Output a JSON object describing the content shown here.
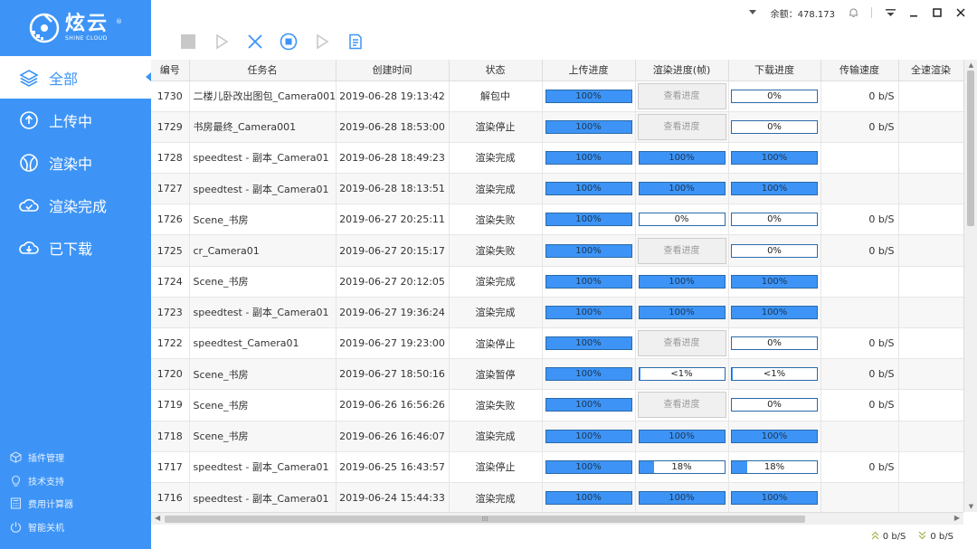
{
  "logo": {
    "name_cn": "炫云",
    "name_en": "SHINE CLOUD",
    "reg": "®"
  },
  "nav": [
    {
      "label": "全部",
      "icon": "layers-icon",
      "active": true
    },
    {
      "label": "上传中",
      "icon": "upload-icon",
      "active": false
    },
    {
      "label": "渲染中",
      "icon": "rendering-icon",
      "active": false
    },
    {
      "label": "渲染完成",
      "icon": "cloud-check-icon",
      "active": false
    },
    {
      "label": "已下载",
      "icon": "cloud-download-icon",
      "active": false
    }
  ],
  "bottom_links": [
    {
      "label": "插件管理",
      "icon": "plugin-icon"
    },
    {
      "label": "技术支持",
      "icon": "lightbulb-icon"
    },
    {
      "label": "费用计算器",
      "icon": "calculator-icon"
    },
    {
      "label": "智能关机",
      "icon": "power-icon"
    }
  ],
  "topbar": {
    "balance_label": "余额：",
    "balance_value": "478.173"
  },
  "table": {
    "headers": [
      "编号",
      "任务名",
      "创建时间",
      "状态",
      "上传进度",
      "渲染进度(帧)",
      "下载进度",
      "传输速度",
      "全速渲染"
    ],
    "view_progress_label": "查看进度",
    "rows": [
      {
        "id": "1730",
        "name": "二楼儿卧改出图包_Camera001",
        "time": "2019-06-28 19:13:42",
        "status": "解包中",
        "upload": "100%",
        "upload_pct": 100,
        "render": "view",
        "download": "0%",
        "download_pct": 0,
        "speed": "0 b/S"
      },
      {
        "id": "1729",
        "name": "书房最终_Camera001",
        "time": "2019-06-28 18:53:00",
        "status": "渲染停止",
        "upload": "100%",
        "upload_pct": 100,
        "render": "view",
        "download": "0%",
        "download_pct": 0,
        "speed": "0 b/S"
      },
      {
        "id": "1728",
        "name": "speedtest - 副本_Camera01",
        "time": "2019-06-28 18:49:23",
        "status": "渲染完成",
        "upload": "100%",
        "upload_pct": 100,
        "render": "100%",
        "render_pct": 100,
        "download": "100%",
        "download_pct": 100,
        "speed": ""
      },
      {
        "id": "1727",
        "name": "speedtest - 副本_Camera01",
        "time": "2019-06-28 18:13:51",
        "status": "渲染完成",
        "upload": "100%",
        "upload_pct": 100,
        "render": "100%",
        "render_pct": 100,
        "download": "100%",
        "download_pct": 100,
        "speed": ""
      },
      {
        "id": "1726",
        "name": "Scene_书房",
        "time": "2019-06-27 20:25:11",
        "status": "渲染失败",
        "upload": "100%",
        "upload_pct": 100,
        "render": "0%",
        "render_pct": 0,
        "download": "0%",
        "download_pct": 0,
        "speed": "0 b/S"
      },
      {
        "id": "1725",
        "name": "cr_Camera01",
        "time": "2019-06-27 20:15:17",
        "status": "渲染失败",
        "upload": "100%",
        "upload_pct": 100,
        "render": "view",
        "download": "0%",
        "download_pct": 0,
        "speed": "0 b/S"
      },
      {
        "id": "1724",
        "name": "Scene_书房",
        "time": "2019-06-27 20:12:05",
        "status": "渲染完成",
        "upload": "100%",
        "upload_pct": 100,
        "render": "100%",
        "render_pct": 100,
        "download": "100%",
        "download_pct": 100,
        "speed": ""
      },
      {
        "id": "1723",
        "name": "speedtest - 副本_Camera01",
        "time": "2019-06-27 19:36:24",
        "status": "渲染完成",
        "upload": "100%",
        "upload_pct": 100,
        "render": "100%",
        "render_pct": 100,
        "download": "100%",
        "download_pct": 100,
        "speed": ""
      },
      {
        "id": "1722",
        "name": "speedtest_Camera01",
        "time": "2019-06-27 19:23:00",
        "status": "渲染停止",
        "upload": "100%",
        "upload_pct": 100,
        "render": "view",
        "download": "0%",
        "download_pct": 0,
        "speed": "0 b/S"
      },
      {
        "id": "1720",
        "name": "Scene_书房",
        "time": "2019-06-27 18:50:16",
        "status": "渲染暂停",
        "upload": "100%",
        "upload_pct": 100,
        "render": "<1%",
        "render_pct": 0.5,
        "download": "<1%",
        "download_pct": 0.5,
        "speed": "0 b/S"
      },
      {
        "id": "1719",
        "name": "Scene_书房",
        "time": "2019-06-26 16:56:26",
        "status": "渲染失败",
        "upload": "100%",
        "upload_pct": 100,
        "render": "view",
        "download": "0%",
        "download_pct": 0,
        "speed": "0 b/S"
      },
      {
        "id": "1718",
        "name": "Scene_书房",
        "time": "2019-06-26 16:46:07",
        "status": "渲染完成",
        "upload": "100%",
        "upload_pct": 100,
        "render": "100%",
        "render_pct": 100,
        "download": "100%",
        "download_pct": 100,
        "speed": ""
      },
      {
        "id": "1717",
        "name": "speedtest - 副本_Camera01",
        "time": "2019-06-25 16:43:57",
        "status": "渲染停止",
        "upload": "100%",
        "upload_pct": 100,
        "render": "18%",
        "render_pct": 18,
        "download": "18%",
        "download_pct": 18,
        "speed": "0 b/S"
      },
      {
        "id": "1716",
        "name": "speedtest - 副本_Camera01",
        "time": "2019-06-24 15:44:33",
        "status": "渲染完成",
        "upload": "100%",
        "upload_pct": 100,
        "render": "100%",
        "render_pct": 100,
        "download": "100%",
        "download_pct": 100,
        "speed": ""
      }
    ]
  },
  "statusbar": {
    "upload_speed": "0 b/S",
    "download_speed": "0 b/S"
  },
  "colors": {
    "brand": "#3d94f6",
    "bar_border": "#2b6aa8"
  }
}
